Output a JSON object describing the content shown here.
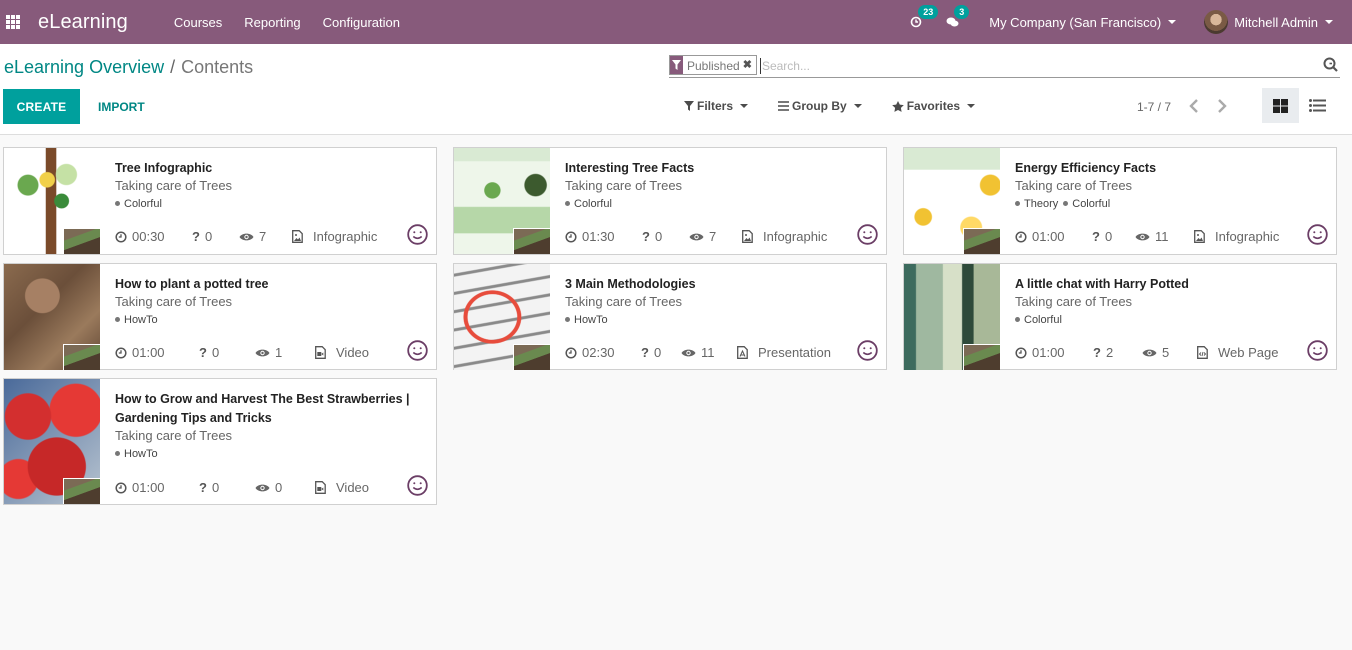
{
  "navbar": {
    "app_name": "eLearning",
    "menu": [
      "Courses",
      "Reporting",
      "Configuration"
    ],
    "activity_count": "23",
    "message_count": "3",
    "company": "My Company (San Francisco)",
    "user": "Mitchell Admin",
    "bg_color": "#875a7b"
  },
  "breadcrumb": {
    "parent": "eLearning Overview",
    "separator": "/",
    "current": "Contents"
  },
  "buttons": {
    "create": "CREATE",
    "import": "IMPORT"
  },
  "search": {
    "facet": "Published",
    "placeholder": "Search...",
    "value": ""
  },
  "filters": {
    "filters": "Filters",
    "group_by": "Group By",
    "favorites": "Favorites"
  },
  "pager": {
    "value": "1-7 / 7"
  },
  "views": {
    "active": "kanban",
    "options": [
      "kanban",
      "list"
    ]
  },
  "accent_color": "#00a09d",
  "cards": [
    {
      "title": "Tree Infographic",
      "course": "Taking care of Trees",
      "tags": [
        "Colorful"
      ],
      "duration": "00:30",
      "questions": "0",
      "views": "7",
      "type": "Infographic",
      "type_icon": "image-file-icon"
    },
    {
      "title": "Interesting Tree Facts",
      "course": "Taking care of Trees",
      "tags": [
        "Colorful"
      ],
      "duration": "01:30",
      "questions": "0",
      "views": "7",
      "type": "Infographic",
      "type_icon": "image-file-icon"
    },
    {
      "title": "Energy Efficiency Facts",
      "course": "Taking care of Trees",
      "tags": [
        "Theory",
        "Colorful"
      ],
      "duration": "01:00",
      "questions": "0",
      "views": "11",
      "type": "Infographic",
      "type_icon": "image-file-icon"
    },
    {
      "title": "How to plant a potted tree",
      "course": "Taking care of Trees",
      "tags": [
        "HowTo"
      ],
      "duration": "01:00",
      "questions": "0",
      "views": "1",
      "type": "Video",
      "type_icon": "video-file-icon"
    },
    {
      "title": "3 Main Methodologies",
      "course": "Taking care of Trees",
      "tags": [
        "HowTo"
      ],
      "duration": "02:30",
      "questions": "0",
      "views": "11",
      "type": "Presentation",
      "type_icon": "pdf-file-icon"
    },
    {
      "title": "A little chat with Harry Potted",
      "course": "Taking care of Trees",
      "tags": [
        "Colorful"
      ],
      "duration": "01:00",
      "questions": "2",
      "views": "5",
      "type": "Web Page",
      "type_icon": "code-file-icon"
    },
    {
      "title": "How to Grow and Harvest The Best Strawberries | Gardening Tips and Tricks",
      "course": "Taking care of Trees",
      "tags": [
        "HowTo"
      ],
      "duration": "01:00",
      "questions": "0",
      "views": "0",
      "type": "Video",
      "type_icon": "video-file-icon"
    }
  ]
}
